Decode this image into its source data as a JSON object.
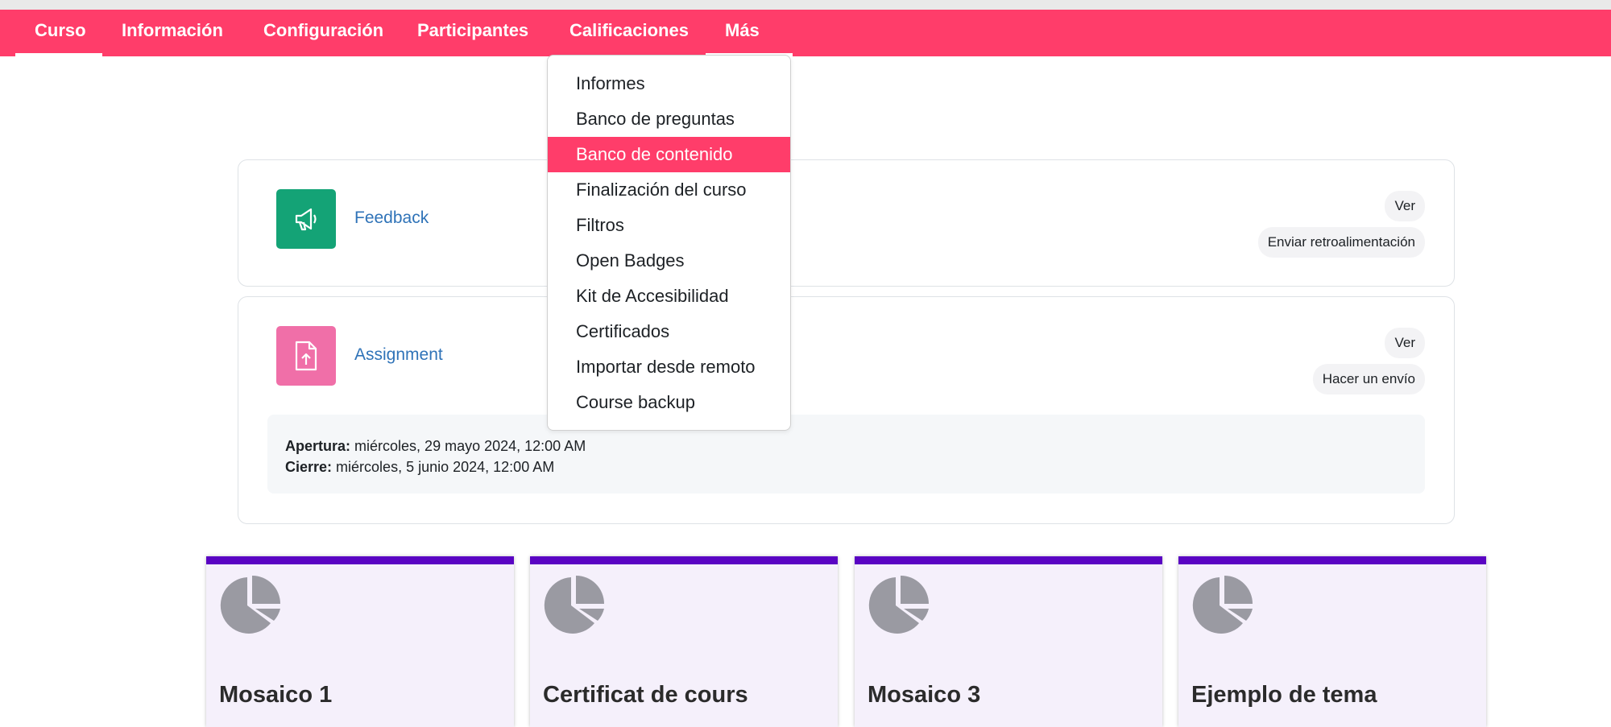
{
  "nav": {
    "items": [
      {
        "label": "Curso"
      },
      {
        "label": "Información"
      },
      {
        "label": "Configuración"
      },
      {
        "label": "Participantes"
      },
      {
        "label": "Calificaciones"
      },
      {
        "label": "Más"
      }
    ],
    "active": "Curso",
    "open_menu": "Más"
  },
  "more_menu": {
    "items": [
      "Informes",
      "Banco de preguntas",
      "Banco de contenido",
      "Finalización del curso",
      "Filtros",
      "Open Badges",
      "Kit de Accesibilidad",
      "Certificados",
      "Importar desde remoto",
      "Course backup"
    ],
    "highlighted": "Banco de contenido"
  },
  "activities": {
    "feedback": {
      "name": "Feedback",
      "icon": "megaphone-icon",
      "icon_color": "#14a376",
      "pill_view": "Ver",
      "pill_action": "Enviar retroalimentación"
    },
    "assignment": {
      "name": "Assignment",
      "icon": "file-upload-icon",
      "icon_color": "#f06fa8",
      "pill_view": "Ver",
      "pill_action": "Hacer un envío",
      "open_label": "Apertura:",
      "open_value": "miércoles, 29 mayo 2024, 12:00 AM",
      "close_label": "Cierre:",
      "close_value": "miércoles, 5 junio 2024, 12:00 AM"
    }
  },
  "tiles": [
    {
      "title": "Mosaico 1",
      "icon": "pie-chart-icon"
    },
    {
      "title": "Certificat de cours",
      "icon": "pie-chart-icon"
    },
    {
      "title": "Mosaico 3",
      "icon": "pie-chart-icon"
    },
    {
      "title": "Ejemplo de tema",
      "icon": "pie-chart-icon"
    }
  ],
  "colors": {
    "nav_bg": "#ff3d6a",
    "tile_accent": "#5a04c3",
    "link": "#2f73b8"
  }
}
